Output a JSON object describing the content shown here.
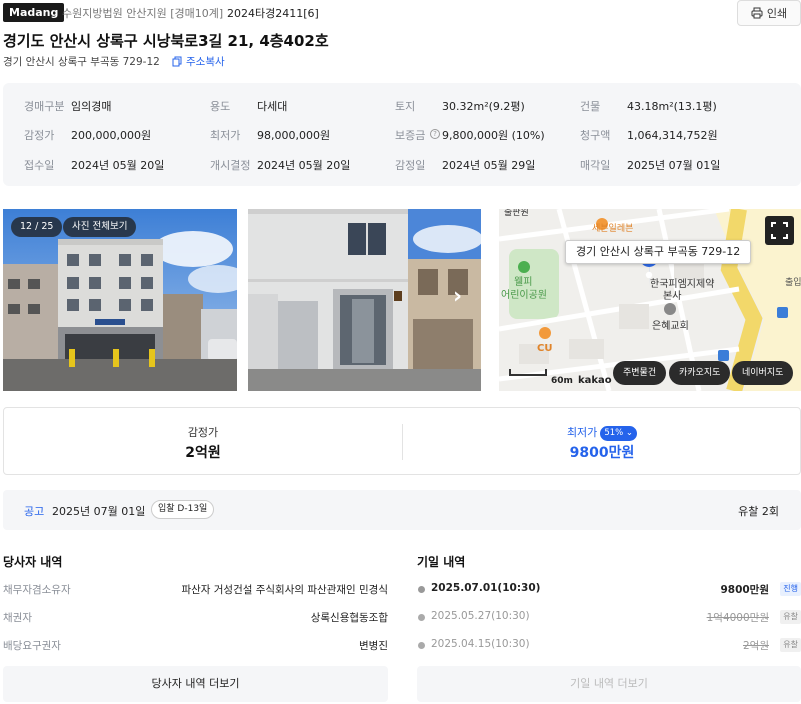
{
  "header": {
    "brand": "Madang",
    "court": "수원지방법원 안산지원 [경매10계]",
    "case_no": "2024타경2411[6]",
    "print_label": "인쇄"
  },
  "property": {
    "title": "경기도 안산시 상록구 시낭북로3길 21, 4층402호",
    "address": "경기 안산시 상록구 부곡동 729-12",
    "copy_label": "주소복사"
  },
  "info": [
    {
      "k": "경매구분",
      "v": "임의경매"
    },
    {
      "k": "용도",
      "v": "다세대"
    },
    {
      "k": "토지",
      "v": "30.32m²(9.2평)"
    },
    {
      "k": "건물",
      "v": "43.18m²(13.1평)"
    },
    {
      "k": "감정가",
      "v": "200,000,000원"
    },
    {
      "k": "최저가",
      "v": "98,000,000원"
    },
    {
      "k": "보증금",
      "v": "9,800,000원 (10%)"
    },
    {
      "k": "청구액",
      "v": "1,064,314,752원"
    },
    {
      "k": "접수일",
      "v": "2024년 05월 20일"
    },
    {
      "k": "개시결정",
      "v": "2024년 05월 20일"
    },
    {
      "k": "감정일",
      "v": "2024년 05월 29일"
    },
    {
      "k": "매각일",
      "v": "2025년 07월 01일"
    }
  ],
  "gallery": {
    "counter": "12 / 25",
    "view_all": "사진 전체보기"
  },
  "map": {
    "label": "경기 안산시 상록구 부곡동 729-12",
    "poi": [
      "출판원",
      "세븐일레븐",
      "웰피",
      "어린이공원",
      "한국피엠지제약",
      "본사",
      "은혜교회",
      "CU",
      "출입"
    ],
    "scale": "60m",
    "provider": "kakao",
    "buttons": [
      "주변물건",
      "카카오지도",
      "네이버지도"
    ]
  },
  "prices": {
    "appraisal_label": "감정가",
    "appraisal_value": "2억원",
    "min_label": "최저가",
    "min_pct": "51%",
    "min_value": "9800만원"
  },
  "notice": {
    "label": "공고",
    "date": "2025년 07월 01일",
    "dday": "입찰 D-13일",
    "fail": "유찰 2회"
  },
  "parties": {
    "title": "당사자 내역",
    "rows": [
      {
        "k": "채무자겸소유자",
        "v": "파산자 거성건설 주식회사의 파산관재인 민경식"
      },
      {
        "k": "채권자",
        "v": "상록신용협동조합"
      },
      {
        "k": "배당요구권자",
        "v": "변병진"
      }
    ],
    "more": "당사자 내역 더보기"
  },
  "history": {
    "title": "기일 내역",
    "rows": [
      {
        "date": "2025.07.01(10:30)",
        "amount": "9800만원",
        "status": "진행"
      },
      {
        "date": "2025.05.27(10:30)",
        "amount": "1억4000만원",
        "status": "유찰"
      },
      {
        "date": "2025.04.15(10:30)",
        "amount": "2억원",
        "status": "유찰"
      }
    ],
    "more": "기일 내역 더보기"
  },
  "colors": {
    "accent": "#2563eb",
    "info_bg": "#f5f6f8",
    "muted": "#8a8f98"
  }
}
